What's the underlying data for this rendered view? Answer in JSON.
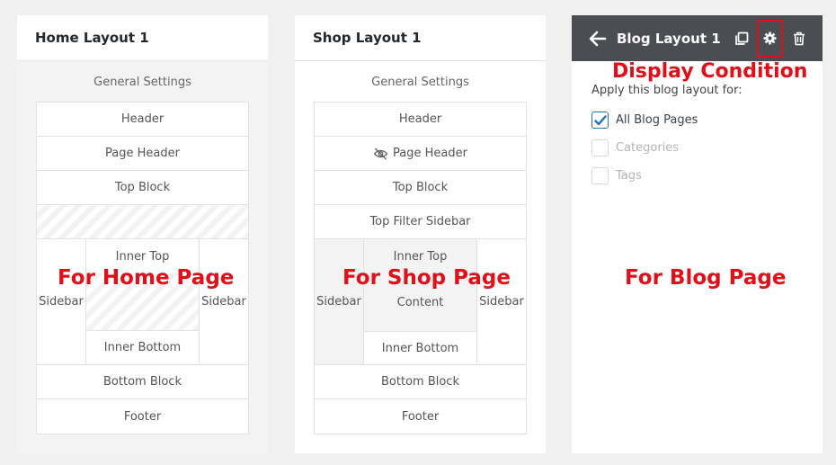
{
  "home": {
    "title": "Home Layout 1",
    "general_settings": "General Settings",
    "header": "Header",
    "page_header": "Page Header",
    "top_block": "Top Block",
    "inner_top": "Inner Top",
    "sidebar_left": "Sidebar",
    "sidebar_right": "Sidebar",
    "inner_bottom": "Inner Bottom",
    "bottom_block": "Bottom Block",
    "footer": "Footer",
    "overlay": "For Home Page"
  },
  "shop": {
    "title": "Shop Layout 1",
    "general_settings": "General Settings",
    "header": "Header",
    "page_header": "Page Header",
    "top_block": "Top Block",
    "top_filter_sidebar": "Top Filter Sidebar",
    "inner_top": "Inner Top",
    "sidebar_left": "Sidebar",
    "content": "Content",
    "sidebar_right": "Sidebar",
    "inner_bottom": "Inner Bottom",
    "bottom_block": "Bottom Block",
    "footer": "Footer",
    "overlay": "For Shop Page"
  },
  "blog": {
    "title": "Blog Layout 1",
    "display_condition": "Display Condition",
    "apply_label": "Apply this blog layout for:",
    "options": [
      {
        "label": "All Blog Pages",
        "checked": true
      },
      {
        "label": "Categories",
        "checked": false
      },
      {
        "label": "Tags",
        "checked": false
      }
    ],
    "overlay": "For Blog Page"
  },
  "icons": {
    "back": "arrow-left-icon",
    "copy": "copy-icon",
    "settings": "gear-icon",
    "delete": "trash-icon",
    "hidden": "eye-slash-icon",
    "check": "checkmark-icon"
  },
  "colors": {
    "annotation": "#e0101a",
    "header_dark": "#4a4d51",
    "checkbox_accent": "#2271b1"
  }
}
